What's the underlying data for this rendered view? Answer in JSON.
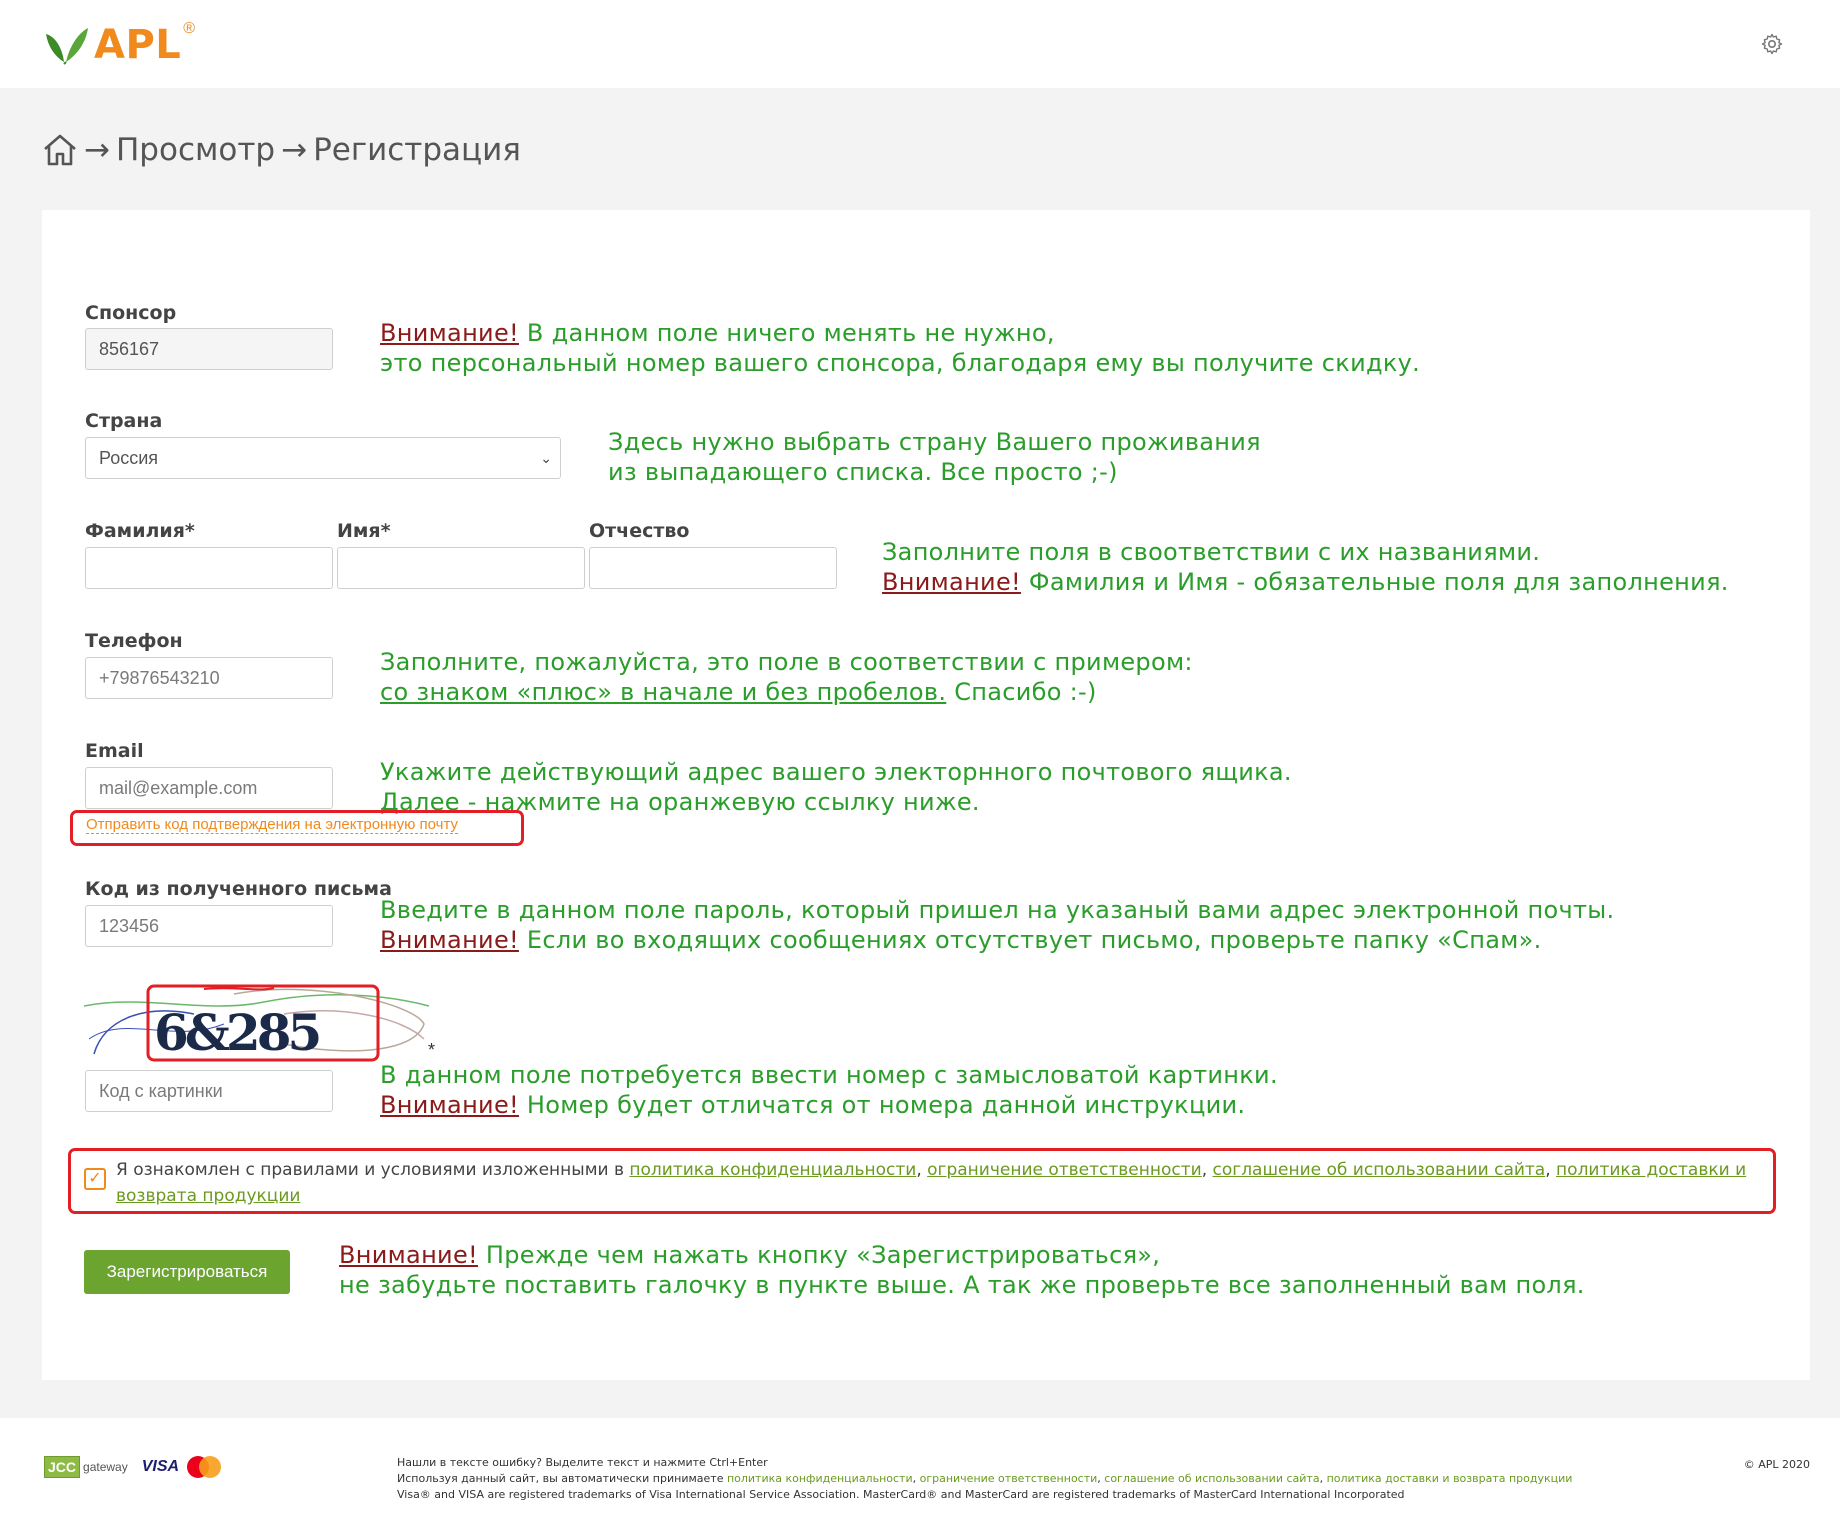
{
  "header": {
    "logo_text": "APL",
    "logo_reg": "®"
  },
  "breadcrumb": {
    "sep1": "→",
    "item1": "Просмотр",
    "sep2": "→",
    "item2": "Регистрация"
  },
  "form": {
    "sponsor_label": "Спонсор",
    "sponsor_value": "856167",
    "country_label": "Страна",
    "country_value": "Россия",
    "lastname_label": "Фамилия*",
    "firstname_label": "Имя*",
    "middlename_label": "Отчество",
    "phone_label": "Телефон",
    "phone_placeholder": "+79876543210",
    "email_label": "Email",
    "email_placeholder": "mail@example.com",
    "send_code_link": "Отправить код подтверждения на электронную почту",
    "code_label": "Код из полученного письма",
    "code_placeholder": "123456",
    "captcha_text": "6&285",
    "captcha_star": "*",
    "captcha_placeholder": "Код с картинки",
    "agree_prefix": "Я ознакомлен с правилами и условиями изложенными в ",
    "agree_link1": "политика конфиденциальности",
    "agree_link2": "ограничение ответственности",
    "agree_link3": "соглашение об использовании сайта",
    "agree_link4": "политика доставки и возврата продукции",
    "checkbox_mark": "✓",
    "submit": "Зарегистрироваться"
  },
  "notes": {
    "attention": "Внимание!",
    "sponsor1": " В данном поле ничего менять не нужно,",
    "sponsor2": "это персональный номер вашего спонсора, благодаря ему вы получите скидку.",
    "country1": "Здесь нужно выбрать страну Вашего проживания",
    "country2": "из выпадающего списка. Все просто ;-)",
    "names1": "Заполните поля в своответствии с их названиями.",
    "names2": " Фамилия и Имя - обязательные поля для заполнения.",
    "phone1": "Заполните, пожалуйста, это поле в соответствии с примером:",
    "phone2": "со знаком «плюс» в начале и без пробелов.",
    "phone3": " Спасибо :-)",
    "email1": "Укажите действующий адрес вашего электорнного почтового ящика.",
    "email2": "Далее - нажмите на оранжевую ссылку ниже.",
    "code1": "Введите в  данном поле пароль, который пришел на указаный вами адрес электронной почты.",
    "code2": " Если во входящих сообщениях отсутствует письмо, проверьте папку «Спам».",
    "captcha1": "В данном поле потребуется ввести номер с замысловатой картинки.",
    "captcha2": " Номер будет отличатся от номера данной инструкции.",
    "submit1": " Прежде чем нажать кнопку «Зарегистрироваться»,",
    "submit2": "не забудьте поставить галочку в пункте выше. А так же проверьте все заполненный вам поля."
  },
  "footer": {
    "jcc": "JCC",
    "gateway": "gateway",
    "visa": "VISA",
    "line1": "Нашли в тексте ошибку? Выделите текст и нажмите Ctrl+Enter",
    "line2_prefix": "Используя данный сайт, вы автоматически принимаете ",
    "link1": "политика конфиденциальности",
    "link2": "ограничение ответственности",
    "link3": "соглашение об использовании сайта",
    "link4": "политика доставки и возврата продукции",
    "line3": "Visa® and VISA are registered trademarks of Visa International Service Association. MasterCard® and MasterCard are registered trademarks of MasterCard International Incorporated",
    "copyright": "© APL 2020"
  },
  "colors": {
    "accent": "#f08a1c",
    "note_green": "#2a9d2a",
    "warn_red": "#8b1a1a",
    "button_green": "#6ba530",
    "highlight_red": "#e31e24"
  }
}
